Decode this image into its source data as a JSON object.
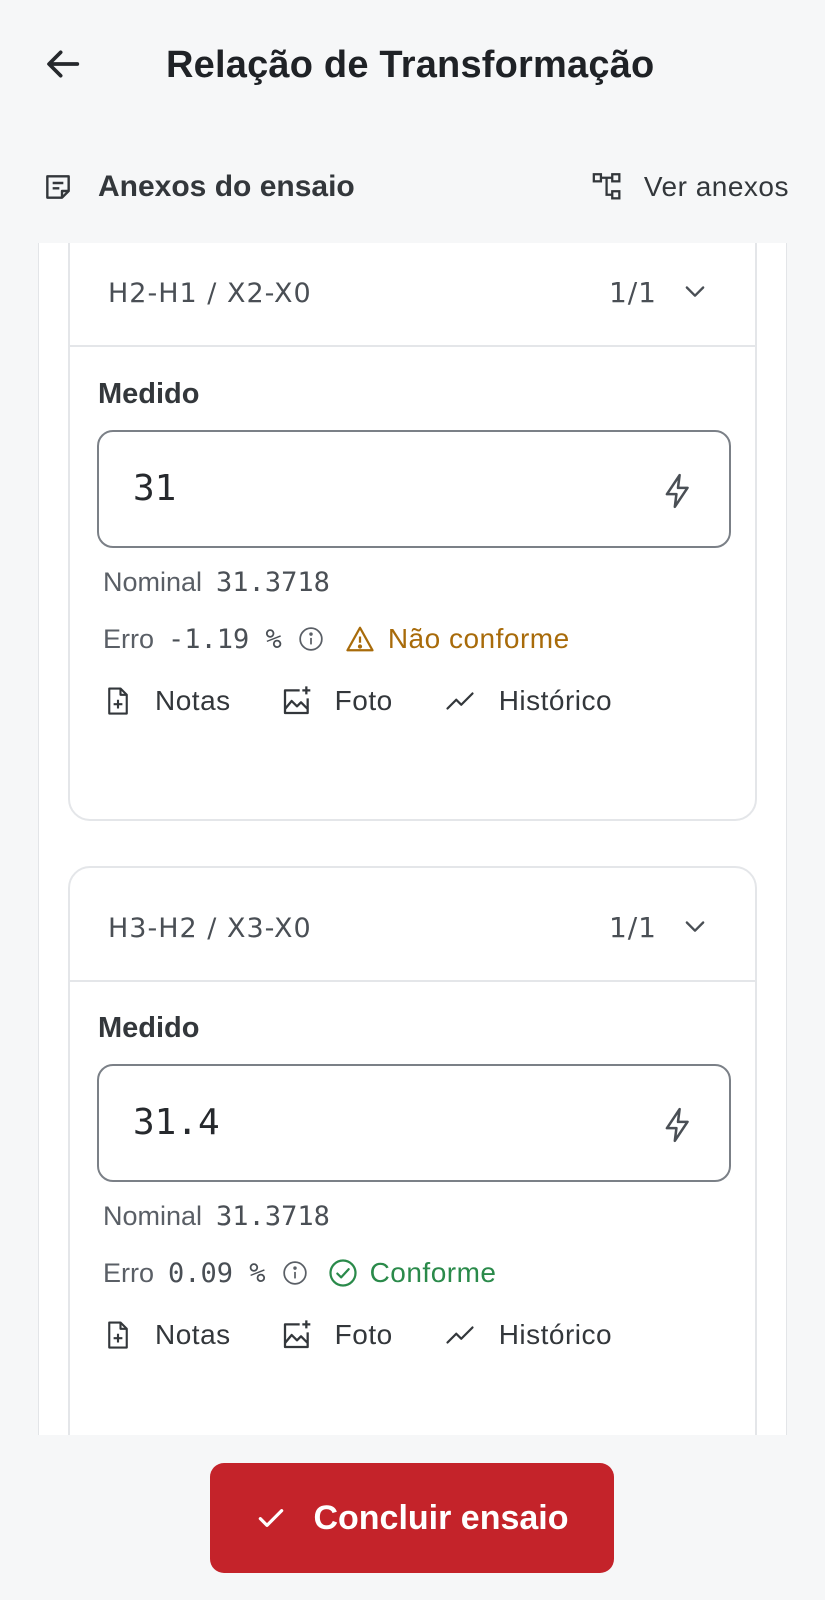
{
  "header": {
    "title": "Relação de Transformação"
  },
  "attachments": {
    "label": "Anexos do ensaio",
    "view_label": "Ver anexos"
  },
  "cards": [
    {
      "name": "H2-H1 / X2-X0",
      "count": "1/1",
      "field_label": "Medido",
      "measured": "31",
      "nominal_label": "Nominal",
      "nominal_value": "31.3718",
      "error_label": "Erro",
      "error_value": "-1.19 %",
      "status": "Não conforme",
      "status_type": "warning",
      "actions": {
        "notes": "Notas",
        "photo": "Foto",
        "history": "Histórico"
      }
    },
    {
      "name": "H3-H2 / X3-X0",
      "count": "1/1",
      "field_label": "Medido",
      "measured": "31.4",
      "nominal_label": "Nominal",
      "nominal_value": "31.3718",
      "error_label": "Erro",
      "error_value": "0.09 %",
      "status": "Conforme",
      "status_type": "ok",
      "actions": {
        "notes": "Notas",
        "photo": "Foto",
        "history": "Histórico"
      }
    }
  ],
  "footer": {
    "button_label": "Concluir ensaio"
  },
  "colors": {
    "primary": "#c4232a",
    "warning": "#a86b0a",
    "success": "#2a8a4a",
    "background": "#f6f7f8"
  },
  "icons": {
    "back": "arrow-left-icon",
    "attachments": "note-icon",
    "view_attachments": "tree-icon",
    "measure": "bolt-icon",
    "info": "info-icon",
    "warning": "warning-triangle-icon",
    "ok": "check-circle-icon",
    "notes": "file-plus-icon",
    "photo": "image-plus-icon",
    "history": "trend-icon",
    "expand": "chevron-down-icon",
    "confirm": "check-icon"
  }
}
